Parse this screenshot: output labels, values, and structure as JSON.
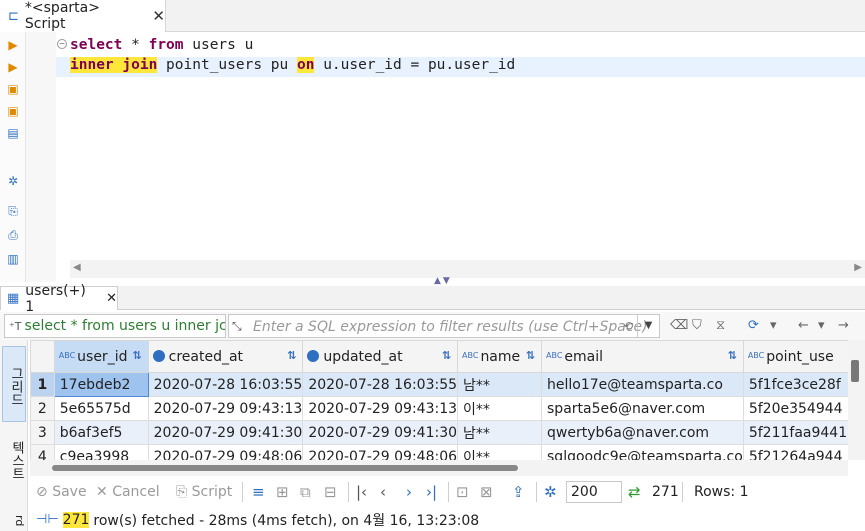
{
  "editor": {
    "tab_title": "*<sparta> Script",
    "close_symbol": "✕",
    "line1_kw1": "select",
    "line1_mid": " * ",
    "line1_kw2": "from",
    "line1_rest": " users u",
    "line2_kw1": "inner",
    "line2_kw2": "join",
    "line2_mid": " point_users pu ",
    "line2_kw3": "on",
    "line2_rest": " u.user_id = pu.user_id"
  },
  "results": {
    "tab_label": "users(+) 1",
    "close_symbol": "✕",
    "sql_preview": "select * from users u inner jc",
    "filter_placeholder": "Enter a SQL expression to filter results (use Ctrl+Space)",
    "vertical_tabs": [
      "그리드",
      "텍스트",
      "rd"
    ],
    "columns": [
      {
        "label": "user_id",
        "type_badge": "ABC"
      },
      {
        "label": "created_at",
        "type_badge": "clock"
      },
      {
        "label": "updated_at",
        "type_badge": "clock"
      },
      {
        "label": "name",
        "type_badge": "ABC"
      },
      {
        "label": "email",
        "type_badge": "ABC"
      },
      {
        "label": "point_use",
        "type_badge": "ABC"
      }
    ],
    "rows": [
      {
        "n": "1",
        "user_id": "17ebdeb2",
        "created_at": "2020-07-28 16:03:55",
        "updated_at": "2020-07-28 16:03:55",
        "name": "남**",
        "email": "hello17e@teamsparta.co",
        "point": "5f1fce3ce28f"
      },
      {
        "n": "2",
        "user_id": "5e65575d",
        "created_at": "2020-07-29 09:43:13",
        "updated_at": "2020-07-29 09:43:13",
        "name": "이**",
        "email": "sparta5e6@naver.com",
        "point": "5f20e354944"
      },
      {
        "n": "3",
        "user_id": "b6af3ef5",
        "created_at": "2020-07-29 09:41:30",
        "updated_at": "2020-07-29 09:41:30",
        "name": "남**",
        "email": "qwertyb6a@naver.com",
        "point": "5f211faa9441"
      },
      {
        "n": "4",
        "user_id": "c9ea3998",
        "created_at": "2020-07-29 09:48:06",
        "updated_at": "2020-07-29 09:48:06",
        "name": "이**",
        "email": "sqlgoodc9e@teamsparta.co",
        "point": "5f21264a944"
      }
    ]
  },
  "toolbar": {
    "save": "Save",
    "cancel": "Cancel",
    "script": "Script",
    "fetch_size": "200",
    "fetched_count": "271",
    "rows_label": "Rows: 1"
  },
  "status": {
    "count": "271",
    "message": " row(s) fetched - 28ms (4ms fetch), on 4월 16, 13:23:08"
  },
  "colors": {
    "keyword": "#7f0055",
    "highlight": "#ffe63a",
    "selection": "#dbe8f8",
    "accent": "#2f6fc1"
  }
}
